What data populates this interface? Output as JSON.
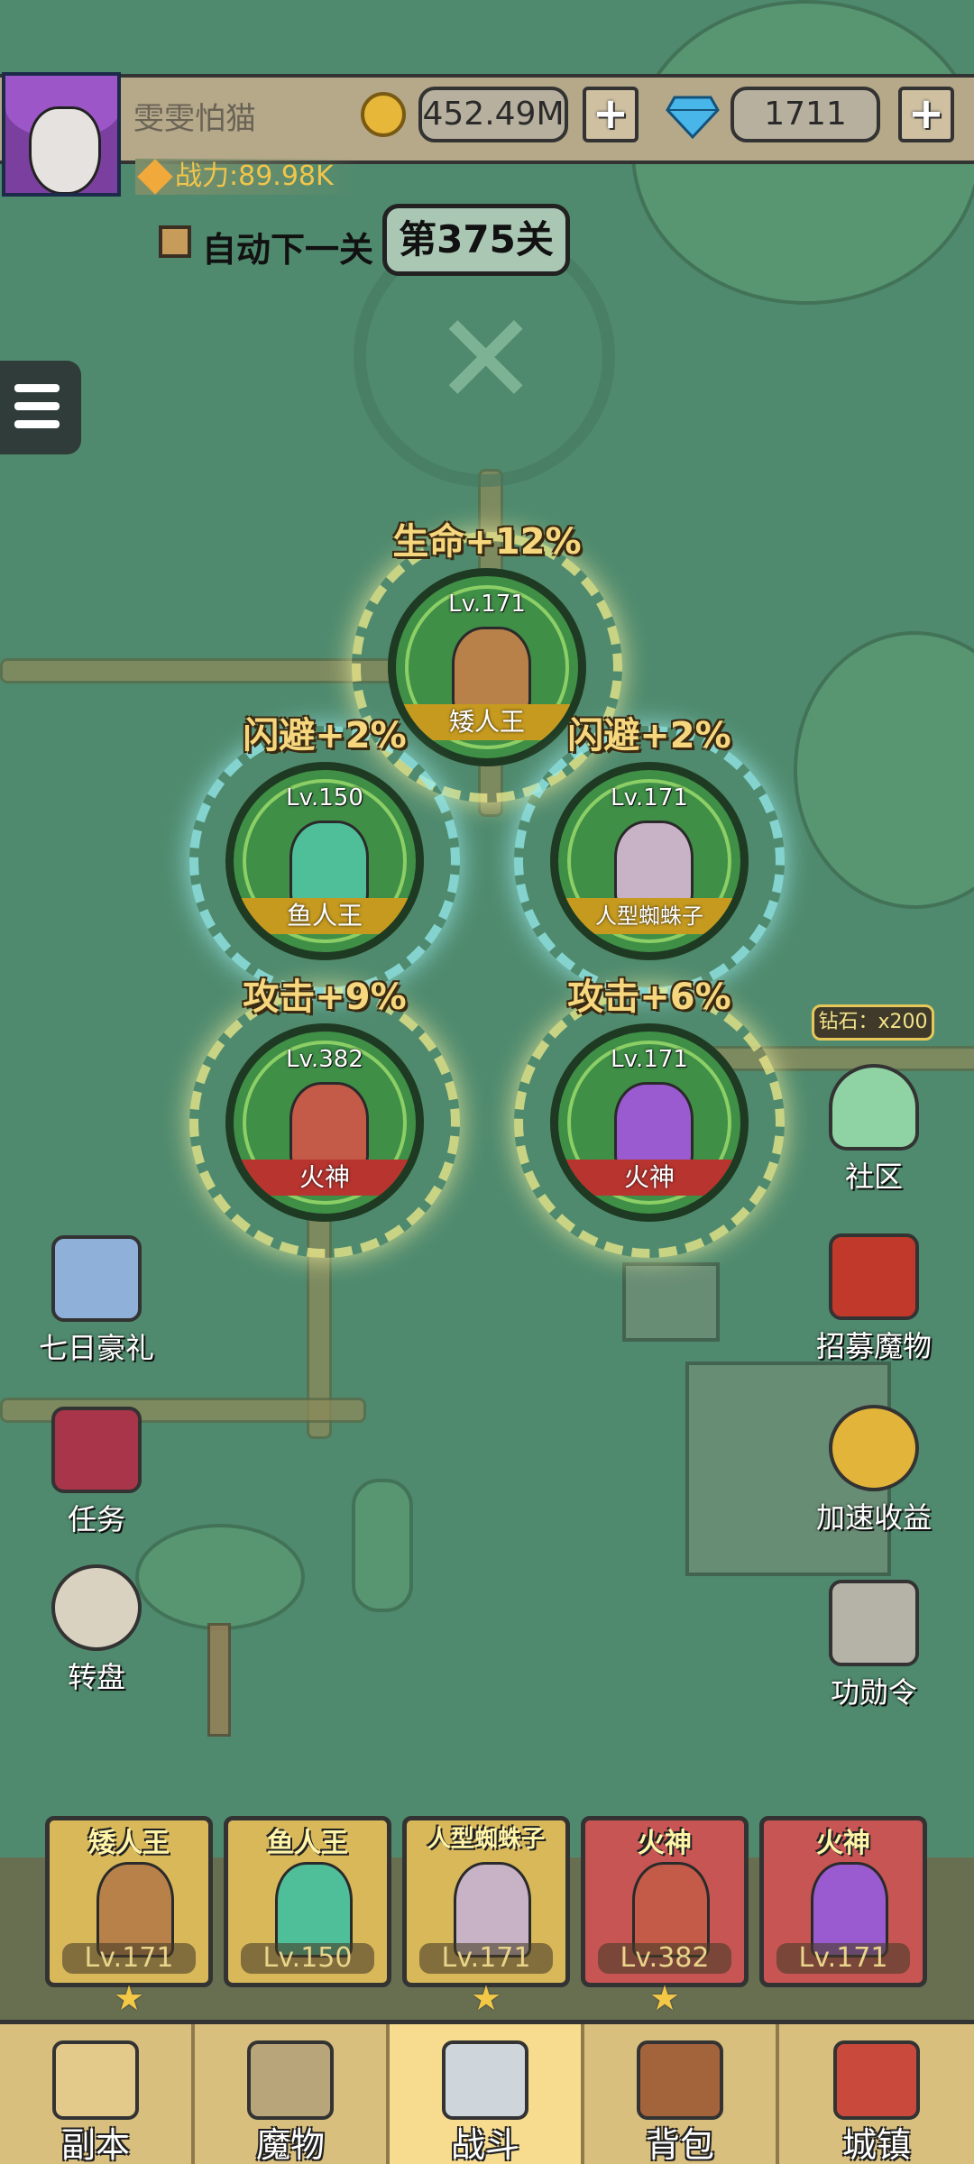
{
  "player": {
    "name": "雯雯怕猫",
    "gold": "452.49M",
    "diamonds": "1711",
    "power": "战力:89.98K"
  },
  "stage": {
    "auto_next_label": "自动下一关",
    "current_level": "第375关"
  },
  "formation": [
    {
      "buff": "生命+12%",
      "level": "Lv.171",
      "name": "矮人王",
      "bar": "gold",
      "color": "#b8814a"
    },
    {
      "buff": "闪避+2%",
      "level": "Lv.150",
      "name": "鱼人王",
      "bar": "gold",
      "color": "#4fbf9a"
    },
    {
      "buff": "闪避+2%",
      "level": "Lv.171",
      "name": "人型蜘蛛子",
      "bar": "gold",
      "color": "#c8b3c6"
    },
    {
      "buff": "攻击+9%",
      "level": "Lv.382",
      "name": "火神",
      "bar": "red",
      "color": "#c45a48"
    },
    {
      "buff": "攻击+6%",
      "level": "Lv.171",
      "name": "火神",
      "bar": "red",
      "color": "#9a5ad0"
    }
  ],
  "left_buttons": [
    {
      "label": "七日豪礼",
      "icon": "knight-helmet-icon"
    },
    {
      "label": "任务",
      "icon": "quest-book-icon"
    },
    {
      "label": "转盘",
      "icon": "wheel-icon"
    }
  ],
  "right_buttons": [
    {
      "label": "社区",
      "icon": "tap-community-icon"
    },
    {
      "label": "招募魔物",
      "icon": "recruit-banner-icon"
    },
    {
      "label": "加速收益",
      "icon": "coin-boost-icon"
    },
    {
      "label": "功勋令",
      "icon": "merit-helmet-icon"
    }
  ],
  "community_tip": "钻石：x200",
  "team": [
    {
      "name": "矮人王",
      "level": "Lv.171",
      "slot_color": "gold",
      "fig_color": "#b8814a",
      "star": true
    },
    {
      "name": "鱼人王",
      "level": "Lv.150",
      "slot_color": "gold",
      "fig_color": "#4fbf9a",
      "star": false
    },
    {
      "name": "人型蜘蛛子",
      "level": "Lv.171",
      "slot_color": "gold",
      "fig_color": "#c8b3c6",
      "star": true
    },
    {
      "name": "火神",
      "level": "Lv.382",
      "slot_color": "red",
      "fig_color": "#c45a48",
      "star": true
    },
    {
      "name": "火神",
      "level": "Lv.171",
      "slot_color": "red",
      "fig_color": "#9a5ad0",
      "star": false
    }
  ],
  "nav": [
    {
      "label": "副本",
      "icon": "map-scroll-icon",
      "active": false
    },
    {
      "label": "魔物",
      "icon": "monster-helmet-icon",
      "active": false
    },
    {
      "label": "战斗",
      "icon": "crossed-swords-icon",
      "active": true
    },
    {
      "label": "背包",
      "icon": "backpack-icon",
      "active": false
    },
    {
      "label": "城镇",
      "icon": "town-shop-icon",
      "active": false
    }
  ]
}
